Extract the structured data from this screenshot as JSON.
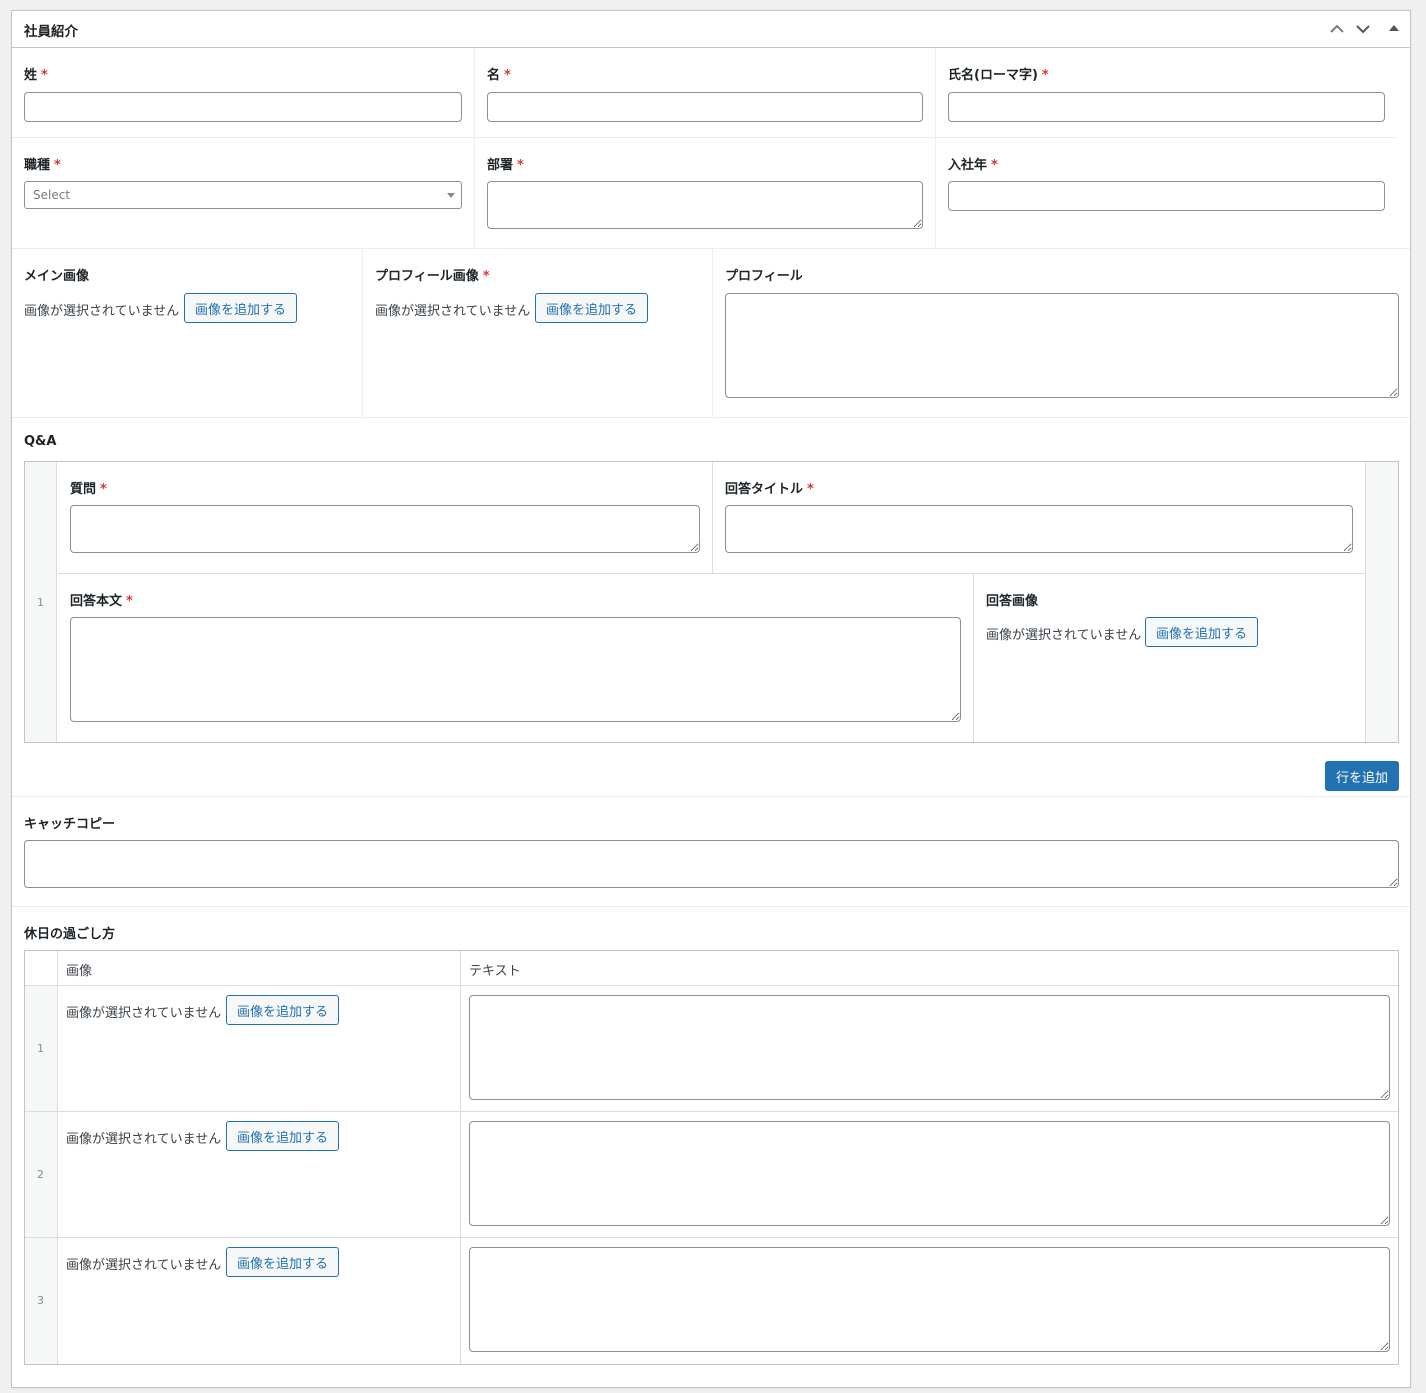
{
  "header": {
    "title": "社員紹介"
  },
  "required_mark": "*",
  "fields": {
    "sei": {
      "label": "姓"
    },
    "mei": {
      "label": "名"
    },
    "romaji": {
      "label": "氏名(ローマ字)"
    },
    "shokushu": {
      "label": "職種",
      "placeholder": "Select"
    },
    "busho": {
      "label": "部署"
    },
    "nyusha": {
      "label": "入社年"
    },
    "main_image": {
      "label": "メイン画像"
    },
    "profile_image": {
      "label": "プロフィール画像"
    },
    "profile": {
      "label": "プロフィール"
    },
    "catchcopy": {
      "label": "キャッチコピー"
    }
  },
  "image": {
    "none_text": "画像が選択されていません",
    "add_label": "画像を追加する"
  },
  "qa": {
    "label": "Q&A",
    "row_number": "1",
    "question_label": "質問",
    "answer_title_label": "回答タイトル",
    "answer_body_label": "回答本文",
    "answer_image_label": "回答画像",
    "add_row_label": "行を追加"
  },
  "holiday": {
    "label": "休日の過ごし方",
    "col_image": "画像",
    "col_text": "テキスト",
    "rows": [
      "1",
      "2",
      "3"
    ]
  }
}
